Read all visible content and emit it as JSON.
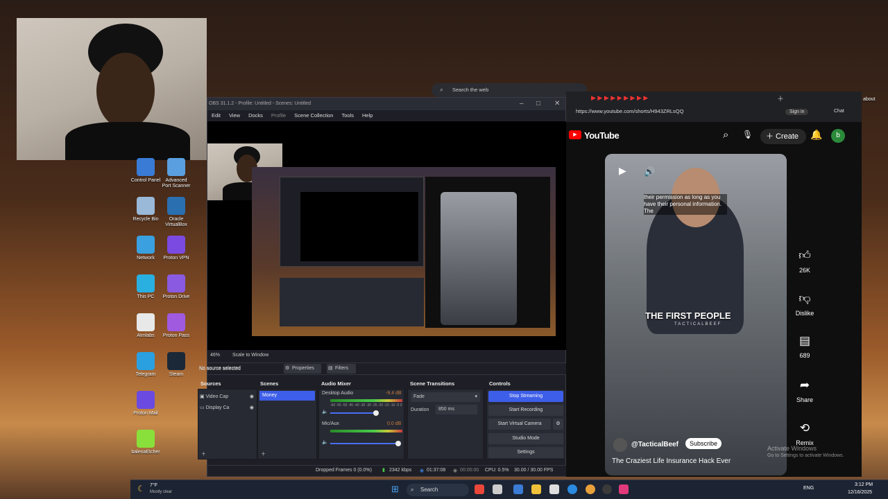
{
  "obs": {
    "title": "OBS 31.1.2 - Profile: Untitled - Scenes: Untitled",
    "menu": [
      "Edit",
      "View",
      "Docks",
      "Profile",
      "Scene Collection",
      "Tools",
      "Help"
    ],
    "zoom_label": "46%",
    "scale_label": "Scale to Window",
    "no_source": "No source selected",
    "properties": "Properties",
    "filters": "Filters",
    "docks": {
      "sources": {
        "title": "Sources",
        "items": [
          "Video Cap",
          "Display Ca"
        ]
      },
      "scenes": {
        "title": "Scenes",
        "items": [
          "Money"
        ]
      },
      "mixer": {
        "title": "Audio Mixer",
        "channels": [
          {
            "name": "Desktop Audio",
            "db": "-9.4 dB"
          },
          {
            "name": "Mic/Aux",
            "db": "0.0 dB"
          }
        ],
        "scale": "-60 -55 -50 -45 -40 -35 -30 -25 -20 -15 -10 -5 0"
      },
      "transitions": {
        "title": "Scene Transitions",
        "type": "Fade",
        "duration_label": "Duration",
        "duration": "850 ms"
      },
      "controls": {
        "title": "Controls",
        "buttons": [
          "Stop Streaming",
          "Start Recording",
          "Start Virtual Camera",
          "Studio Mode",
          "Settings"
        ]
      }
    },
    "status": {
      "dropped": "Dropped Frames 0 (0.0%)",
      "kbps": "2342 kbps",
      "live_time": "01:37:08",
      "rec_time": "00:00:00",
      "cpu": "CPU: 0.5%",
      "fps": "30.00 / 30.00 FPS"
    }
  },
  "browser": {
    "search_placeholder": "Search the web",
    "url": "https://www.youtube.com/shorts/H943ZRLsQQ",
    "signin": "Sign in",
    "chat": "Chat",
    "youtube": {
      "logo": "YouTube",
      "create": "Create",
      "avatar_letter": "b",
      "short": {
        "caption_top": "their permission as long as you have their personal information. The",
        "caption_center": "THE FIRST PEOPLE",
        "caption_brand": "TACTICALBEEF",
        "channel": "@TacticalBeef",
        "subscribe": "Subscribe",
        "title": "The Craziest Life Insurance Hack Ever"
      },
      "actions": [
        {
          "icon": "thumb-up-icon",
          "label": "26K"
        },
        {
          "icon": "thumb-down-icon",
          "label": "Dislike"
        },
        {
          "icon": "comment-icon",
          "label": "689"
        },
        {
          "icon": "share-icon",
          "label": "Share"
        },
        {
          "icon": "remix-icon",
          "label": "Remix"
        }
      ]
    },
    "watermark_1": "Activate Windows",
    "watermark_2": "Go to Settings to activate Windows."
  },
  "desktop": {
    "icons": [
      {
        "label": "Control Panel",
        "color": "#3a7bd5"
      },
      {
        "label": "Advanced Port Scanner",
        "color": "#5aa0e0"
      },
      {
        "label": "Recycle Bin",
        "color": "#9ab8d8"
      },
      {
        "label": "Oracle VirtualBox",
        "color": "#2a6fb0"
      },
      {
        "label": "Network",
        "color": "#3aa0e0"
      },
      {
        "label": "Proton VPN",
        "color": "#7b4ae0"
      },
      {
        "label": "This PC",
        "color": "#2ab0e0"
      },
      {
        "label": "Proton Drive",
        "color": "#8a5ae0"
      },
      {
        "label": "AImlabs",
        "color": "#e8e8e8"
      },
      {
        "label": "Proton Pass",
        "color": "#a05ae0"
      },
      {
        "label": "Telegram",
        "color": "#2aa0e0"
      },
      {
        "label": "Steam",
        "color": "#1b2838"
      },
      {
        "label": "Proton Mail",
        "color": "#6a4ae0"
      },
      {
        "label": "",
        "color": "transparent"
      },
      {
        "label": "balenaEtcher",
        "color": "#8ae03a"
      }
    ],
    "about": "about"
  },
  "taskbar": {
    "weather_temp": "7°F",
    "weather_text": "Mostly clear",
    "search": "Search",
    "lang": "ENG",
    "time": "3:12 PM",
    "date": "12/16/2025"
  }
}
